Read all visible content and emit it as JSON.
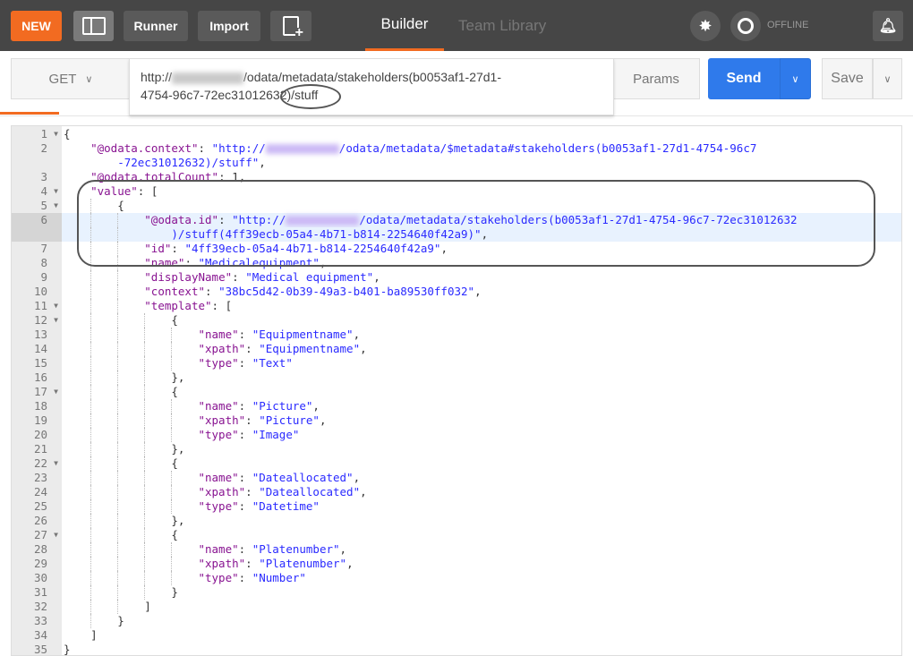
{
  "topbar": {
    "new": "NEW",
    "runner": "Runner",
    "import": "Import",
    "tabs": [
      "Builder",
      "Team Library"
    ],
    "offline": "OFFLINE",
    "accent": "#f26b21"
  },
  "request": {
    "method": "GET",
    "url_prefix": "http://",
    "url_rest_line1": "/odata/metadata/stakeholders(b0053af1-27d1-",
    "url_line2": "4754-96c7-72ec31012632)/stuff",
    "params": "Params",
    "send": "Send",
    "save": "Save",
    "send_color": "#2f7aeb"
  },
  "editor": {
    "lines": [
      {
        "n": 1,
        "d": 0,
        "f": 1,
        "t": [
          [
            "p",
            "{"
          ]
        ]
      },
      {
        "n": 2,
        "d": 1,
        "t": [
          [
            "k",
            "\"@odata.context\""
          ],
          [
            "p",
            ": "
          ],
          [
            "s",
            "\"http://"
          ],
          [
            "b",
            ""
          ],
          [
            "s",
            "/odata/metadata/$metadata#stakeholders(b0053af1-27d1-4754-96c7"
          ]
        ],
        "c": [
          [
            "s",
            "-72ec31012632)/stuff\""
          ],
          [
            "p",
            ","
          ]
        ]
      },
      {
        "n": 3,
        "d": 1,
        "t": [
          [
            "k",
            "\"@odata.totalCount\""
          ],
          [
            "p",
            ": "
          ],
          [
            "n",
            "1"
          ],
          [
            "p",
            ","
          ]
        ]
      },
      {
        "n": 4,
        "d": 1,
        "f": 1,
        "t": [
          [
            "k",
            "\"value\""
          ],
          [
            "p",
            ": ["
          ]
        ]
      },
      {
        "n": 5,
        "d": 2,
        "f": 1,
        "t": [
          [
            "p",
            "{"
          ]
        ]
      },
      {
        "n": 6,
        "d": 3,
        "hl": 1,
        "t": [
          [
            "k",
            "\"@odata.id\""
          ],
          [
            "p",
            ": "
          ],
          [
            "s",
            "\"http://"
          ],
          [
            "b",
            ""
          ],
          [
            "s",
            "/odata/metadata/stakeholders(b0053af1-27d1-4754-96c7-72ec31012632"
          ]
        ],
        "c": [
          [
            "s",
            ")/stuff(4ff39ecb-05a4-4b71-b814-2254640f42a9)\""
          ],
          [
            "p",
            ","
          ]
        ]
      },
      {
        "n": 7,
        "d": 3,
        "t": [
          [
            "k",
            "\"id\""
          ],
          [
            "p",
            ": "
          ],
          [
            "s",
            "\"4ff39ecb-05a4-4b71-b814-2254640f42a9\""
          ],
          [
            "p",
            ","
          ]
        ]
      },
      {
        "n": 8,
        "d": 3,
        "t": [
          [
            "k",
            "\"name\""
          ],
          [
            "p",
            ": "
          ],
          [
            "s",
            "\"Medicalequipment\""
          ],
          [
            "p",
            ","
          ]
        ]
      },
      {
        "n": 9,
        "d": 3,
        "t": [
          [
            "k",
            "\"displayName\""
          ],
          [
            "p",
            ": "
          ],
          [
            "s",
            "\"Medical equipment\""
          ],
          [
            "p",
            ","
          ]
        ]
      },
      {
        "n": 10,
        "d": 3,
        "t": [
          [
            "k",
            "\"context\""
          ],
          [
            "p",
            ": "
          ],
          [
            "s",
            "\"38bc5d42-0b39-49a3-b401-ba89530ff032\""
          ],
          [
            "p",
            ","
          ]
        ]
      },
      {
        "n": 11,
        "d": 3,
        "f": 1,
        "t": [
          [
            "k",
            "\"template\""
          ],
          [
            "p",
            ": ["
          ]
        ]
      },
      {
        "n": 12,
        "d": 4,
        "f": 1,
        "t": [
          [
            "p",
            "{"
          ]
        ]
      },
      {
        "n": 13,
        "d": 5,
        "t": [
          [
            "k",
            "\"name\""
          ],
          [
            "p",
            ": "
          ],
          [
            "s",
            "\"Equipmentname\""
          ],
          [
            "p",
            ","
          ]
        ]
      },
      {
        "n": 14,
        "d": 5,
        "t": [
          [
            "k",
            "\"xpath\""
          ],
          [
            "p",
            ": "
          ],
          [
            "s",
            "\"Equipmentname\""
          ],
          [
            "p",
            ","
          ]
        ]
      },
      {
        "n": 15,
        "d": 5,
        "t": [
          [
            "k",
            "\"type\""
          ],
          [
            "p",
            ": "
          ],
          [
            "s",
            "\"Text\""
          ]
        ]
      },
      {
        "n": 16,
        "d": 4,
        "t": [
          [
            "p",
            "},"
          ]
        ]
      },
      {
        "n": 17,
        "d": 4,
        "f": 1,
        "t": [
          [
            "p",
            "{"
          ]
        ]
      },
      {
        "n": 18,
        "d": 5,
        "t": [
          [
            "k",
            "\"name\""
          ],
          [
            "p",
            ": "
          ],
          [
            "s",
            "\"Picture\""
          ],
          [
            "p",
            ","
          ]
        ]
      },
      {
        "n": 19,
        "d": 5,
        "t": [
          [
            "k",
            "\"xpath\""
          ],
          [
            "p",
            ": "
          ],
          [
            "s",
            "\"Picture\""
          ],
          [
            "p",
            ","
          ]
        ]
      },
      {
        "n": 20,
        "d": 5,
        "t": [
          [
            "k",
            "\"type\""
          ],
          [
            "p",
            ": "
          ],
          [
            "s",
            "\"Image\""
          ]
        ]
      },
      {
        "n": 21,
        "d": 4,
        "t": [
          [
            "p",
            "},"
          ]
        ]
      },
      {
        "n": 22,
        "d": 4,
        "f": 1,
        "t": [
          [
            "p",
            "{"
          ]
        ]
      },
      {
        "n": 23,
        "d": 5,
        "t": [
          [
            "k",
            "\"name\""
          ],
          [
            "p",
            ": "
          ],
          [
            "s",
            "\"Dateallocated\""
          ],
          [
            "p",
            ","
          ]
        ]
      },
      {
        "n": 24,
        "d": 5,
        "t": [
          [
            "k",
            "\"xpath\""
          ],
          [
            "p",
            ": "
          ],
          [
            "s",
            "\"Dateallocated\""
          ],
          [
            "p",
            ","
          ]
        ]
      },
      {
        "n": 25,
        "d": 5,
        "t": [
          [
            "k",
            "\"type\""
          ],
          [
            "p",
            ": "
          ],
          [
            "s",
            "\"Datetime\""
          ]
        ]
      },
      {
        "n": 26,
        "d": 4,
        "t": [
          [
            "p",
            "},"
          ]
        ]
      },
      {
        "n": 27,
        "d": 4,
        "f": 1,
        "t": [
          [
            "p",
            "{"
          ]
        ]
      },
      {
        "n": 28,
        "d": 5,
        "t": [
          [
            "k",
            "\"name\""
          ],
          [
            "p",
            ": "
          ],
          [
            "s",
            "\"Platenumber\""
          ],
          [
            "p",
            ","
          ]
        ]
      },
      {
        "n": 29,
        "d": 5,
        "t": [
          [
            "k",
            "\"xpath\""
          ],
          [
            "p",
            ": "
          ],
          [
            "s",
            "\"Platenumber\""
          ],
          [
            "p",
            ","
          ]
        ]
      },
      {
        "n": 30,
        "d": 5,
        "t": [
          [
            "k",
            "\"type\""
          ],
          [
            "p",
            ": "
          ],
          [
            "s",
            "\"Number\""
          ]
        ]
      },
      {
        "n": 31,
        "d": 4,
        "t": [
          [
            "p",
            "}"
          ]
        ]
      },
      {
        "n": 32,
        "d": 3,
        "t": [
          [
            "p",
            "]"
          ]
        ]
      },
      {
        "n": 33,
        "d": 2,
        "t": [
          [
            "p",
            "}"
          ]
        ]
      },
      {
        "n": 34,
        "d": 1,
        "t": [
          [
            "p",
            "]"
          ]
        ]
      },
      {
        "n": 35,
        "d": 0,
        "t": [
          [
            "p",
            "}"
          ]
        ]
      }
    ]
  }
}
